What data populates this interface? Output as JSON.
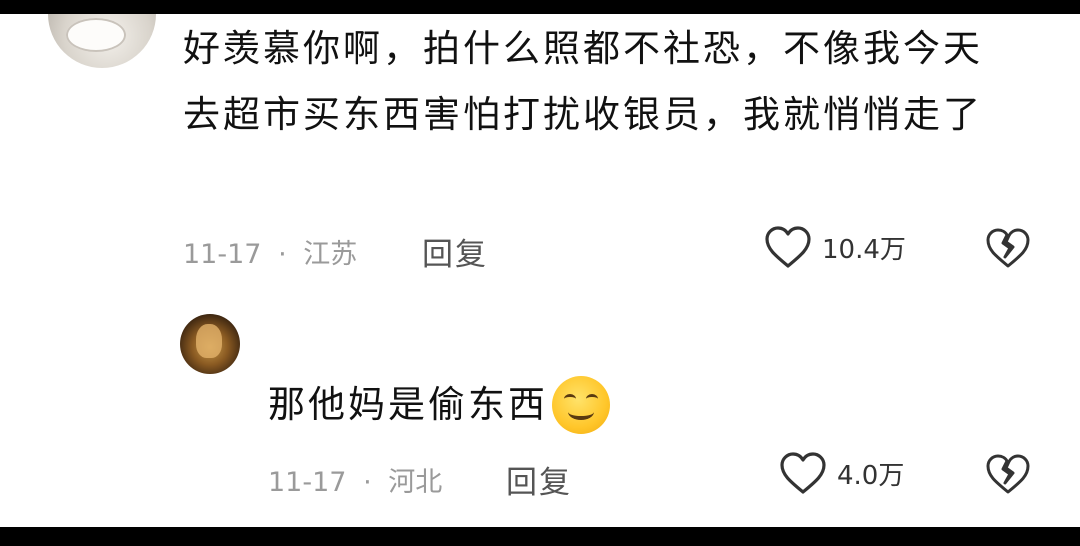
{
  "comments": [
    {
      "text": "好羡慕你啊，拍什么照都不社恐，不像我今天去超市买东西害怕打扰收银员，我就悄悄走了",
      "date": "11-17",
      "separator": "·",
      "location": "江苏",
      "reply_label": "回复",
      "likes": "10.4万"
    },
    {
      "text": "那他妈是偷东西",
      "emoji": "smiling-face",
      "date": "11-17",
      "separator": "·",
      "location": "河北",
      "reply_label": "回复",
      "likes": "4.0万"
    }
  ],
  "icons": {
    "like": "heart-outline-icon",
    "dislike": "broken-heart-icon"
  },
  "colors": {
    "text": "#111111",
    "meta": "#9a9a9a",
    "icon": "#333333",
    "background": "#ffffff"
  }
}
